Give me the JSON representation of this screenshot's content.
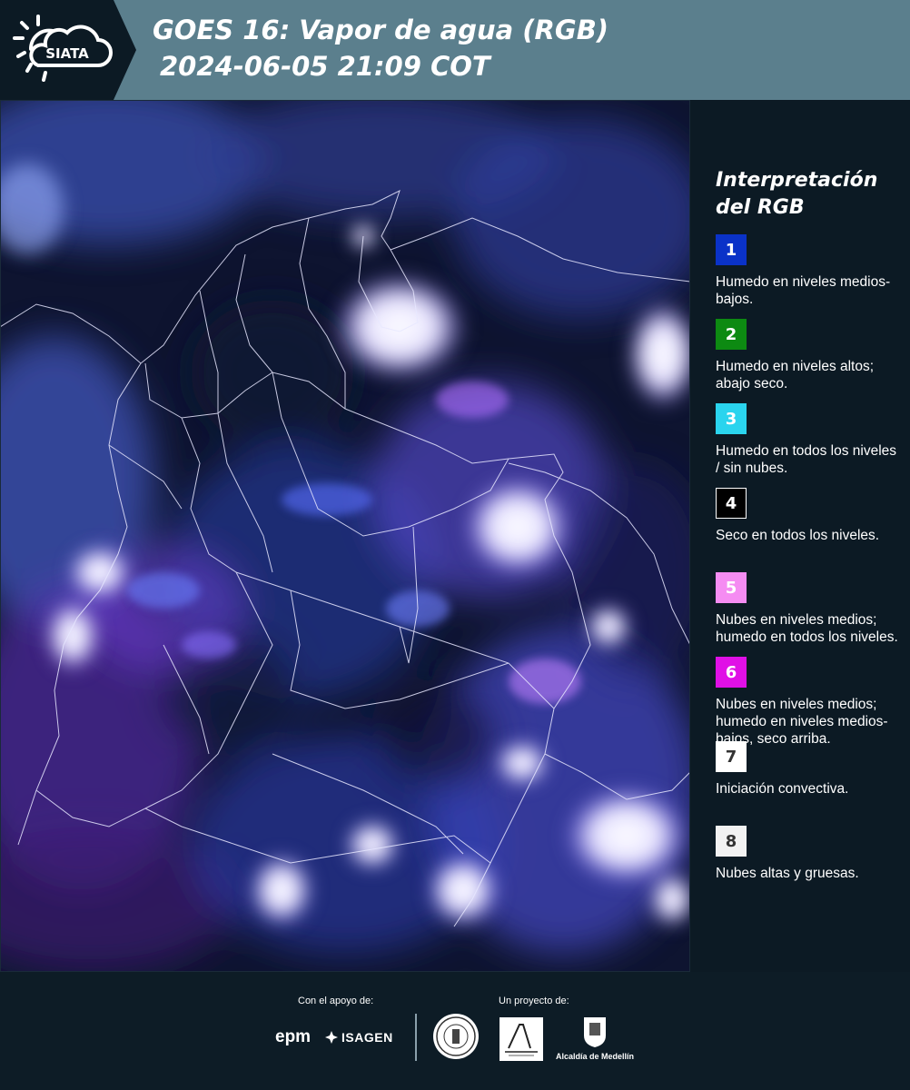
{
  "header": {
    "logo_text": "SIATA",
    "title_line1": "GOES 16: Vapor de agua (RGB)",
    "title_line2": "2024-06-05 21:09 COT",
    "background_color": "#5b7f8d"
  },
  "legend": {
    "title": "Interpretación del RGB",
    "items": [
      {
        "num": "1",
        "color": "#0a32c8",
        "text_color": "#ffffff",
        "description": "Humedo en niveles medios-bajos."
      },
      {
        "num": "2",
        "color": "#0d8a12",
        "text_color": "#ffffff",
        "description": "Humedo en niveles altos; abajo seco."
      },
      {
        "num": "3",
        "color": "#2ad4ee",
        "text_color": "#ffffff",
        "description": "Humedo en todos los niveles / sin nubes."
      },
      {
        "num": "4",
        "color": "#000000",
        "text_color": "#ffffff",
        "description": "Seco en todos los niveles."
      },
      {
        "num": "5",
        "color": "#f58cf2",
        "text_color": "#ffffff",
        "description": "Nubes en niveles medios; humedo en todos los niveles."
      },
      {
        "num": "6",
        "color": "#e010e6",
        "text_color": "#ffffff",
        "description": "Nubes en niveles medios; humedo en niveles medios-bajos, seco arriba."
      },
      {
        "num": "7",
        "color": "#ffffff",
        "text_color": "#333333",
        "description": "Iniciación convectiva."
      },
      {
        "num": "8",
        "color": "#f2f2f2",
        "text_color": "#333333",
        "description": "Nubes altas y gruesas."
      }
    ]
  },
  "footer": {
    "support_label": "Con el apoyo de:",
    "project_label": "Un proyecto de:",
    "epm_text": "epm",
    "isagen_text": "ISAGEN",
    "alcaldia_text": "Alcaldía de Medellín"
  }
}
